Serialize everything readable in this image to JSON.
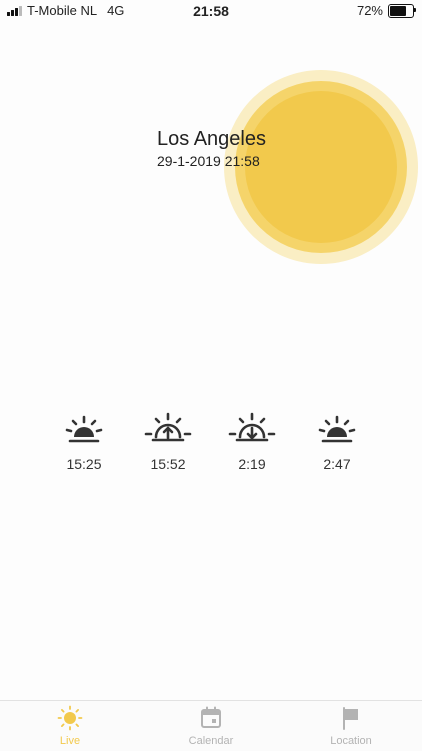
{
  "status_bar": {
    "carrier": "T-Mobile NL",
    "network": "4G",
    "time": "21:58",
    "battery": "72%",
    "battery_level": 0.72
  },
  "location": {
    "city": "Los Angeles",
    "datetime": "29-1-2019 21:58"
  },
  "sun_times": [
    {
      "icon": "sunrise-icon",
      "time": "15:25"
    },
    {
      "icon": "sunrise-up-arrow-icon",
      "time": "15:52"
    },
    {
      "icon": "sunset-down-arrow-icon",
      "time": "2:19"
    },
    {
      "icon": "sunset-icon",
      "time": "2:47"
    }
  ],
  "tabs": [
    {
      "label": "Live",
      "icon": "sun-icon",
      "active": true
    },
    {
      "label": "Calendar",
      "icon": "calendar-icon",
      "active": false
    },
    {
      "label": "Location",
      "icon": "flag-icon",
      "active": false
    }
  ],
  "colors": {
    "sun_core": "#f2c94c",
    "sun_mid": "#f5d46a",
    "sun_halo": "#faeec4",
    "accent": "#f2c94c",
    "inactive_tab": "#b3b3b3"
  }
}
